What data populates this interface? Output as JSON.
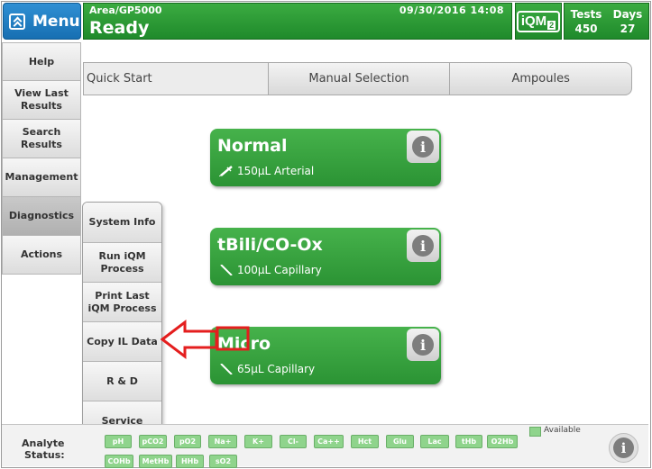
{
  "header": {
    "menu_label": "Menu",
    "area": "Area/GP5000",
    "status": "Ready",
    "datetime": "09/30/2016 14:08",
    "iqm_label": "iQM",
    "iqm_badge": "2",
    "tests_label": "Tests",
    "tests_value": "450",
    "days_label": "Days",
    "days_value": "27"
  },
  "sidebar": {
    "items": [
      {
        "label": "Help"
      },
      {
        "label": "View Last Results"
      },
      {
        "label": "Search Results"
      },
      {
        "label": "Management"
      },
      {
        "label": "Diagnostics"
      },
      {
        "label": "Actions"
      }
    ]
  },
  "tabs": [
    {
      "label": "Quick Start"
    },
    {
      "label": "Manual Selection"
    },
    {
      "label": "Ampoules"
    }
  ],
  "panels": [
    {
      "title": "Normal",
      "subtitle": "150µL Arterial",
      "icon": "syringe-icon"
    },
    {
      "title": "tBili/CO-Ox",
      "subtitle": "100µL Capillary",
      "icon": "capillary-icon"
    },
    {
      "title": "Micro",
      "subtitle": "65µL Capillary",
      "icon": "capillary-icon"
    }
  ],
  "submenu": {
    "items": [
      {
        "label": "System Info"
      },
      {
        "label": "Run iQM Process"
      },
      {
        "label": "Print Last iQM Process"
      },
      {
        "label": "Copy IL Data"
      },
      {
        "label": "R & D"
      },
      {
        "label": "Service"
      }
    ]
  },
  "analytes": {
    "label_line1": "Analyte",
    "label_line2": "Status:",
    "legend": "Available",
    "chips": [
      "pH",
      "pCO2",
      "pO2",
      "Na+",
      "K+",
      "Cl-",
      "Ca++",
      "Hct",
      "Glu",
      "Lac",
      "tHb",
      "O2Hb",
      "COHb",
      "MetHb",
      "HHb",
      "sO2"
    ]
  },
  "colors": {
    "accent_green": "#2b9334",
    "menu_blue": "#176fb2",
    "callout_red": "#e41e1e",
    "chip_green": "#8fd48c"
  }
}
